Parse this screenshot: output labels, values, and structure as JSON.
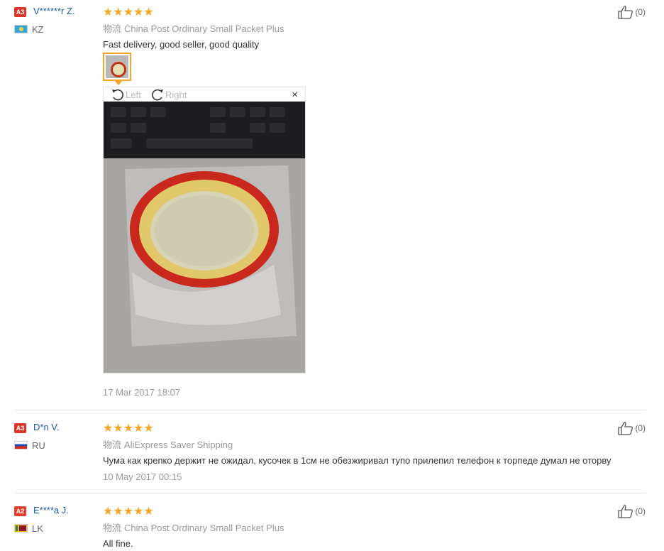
{
  "reviews": [
    {
      "badge": "A3",
      "username": "V******r Z.",
      "country": "KZ",
      "stars": "★★★★★",
      "logistics_label": "物流",
      "logistics": "China Post Ordinary Small Packet Plus",
      "comment": "Fast delivery, good seller, good quality",
      "date": "17 Mar 2017 18:07",
      "helpful": "(0)",
      "viewer": {
        "left_label": "Left",
        "right_label": "Right",
        "close": "×"
      }
    },
    {
      "badge": "A3",
      "username": "D*n V.",
      "country": "RU",
      "stars": "★★★★★",
      "logistics_label": "物流",
      "logistics": "AliExpress Saver Shipping",
      "comment": "Чума как крепко держит не ожидал, кусочек в 1см не обезжиривал тупо прилепил телефон к торпеде думал не оторву",
      "date": "10 May 2017 00:15",
      "helpful": "(0)"
    },
    {
      "badge": "A2",
      "username": "E****a J.",
      "country": "LK",
      "stars": "★★★★★",
      "logistics_label": "物流",
      "logistics": "China Post Ordinary Small Packet Plus",
      "comment": "All fine.",
      "helpful": "(0)"
    }
  ],
  "colors": {
    "star": "#f5a623",
    "username": "#1a5aa8",
    "badge": "#d9362b"
  }
}
